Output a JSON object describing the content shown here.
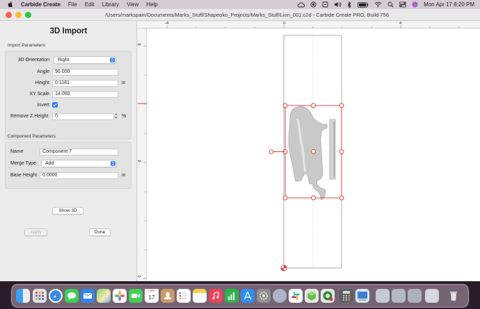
{
  "menubar": {
    "app_name": "Carbide Create",
    "menus": [
      "File",
      "Edit",
      "Library",
      "View",
      "Help"
    ],
    "clock": "Mon Apr 17  8:20 PM",
    "icons": [
      "apple-icon",
      "cloud-icon",
      "record-icon",
      "vpn-icon",
      "volume-icon",
      "bluetooth-icon",
      "battery-icon",
      "wifi-icon",
      "spotlight-icon",
      "control-center-icon",
      "siri-icon"
    ]
  },
  "window": {
    "title": "/Users/markspain/Documents/Marks_Stuff/Shapeoko_Projects/Marks_Stuff/Lion_001.c2d - Carbide Create PRO, Build 756"
  },
  "panel": {
    "title": "3D Import",
    "import_group": {
      "label": "Import Parameters",
      "orientation_label": "3D Orientation",
      "orientation_value": "Right",
      "angle_label": "Angle",
      "angle_value": "90.000",
      "height_label": "Height",
      "height_value": "0.1181",
      "height_unit": "in",
      "xyscale_label": "XY Scale",
      "xyscale_value": "14.000",
      "invert_label": "Invert",
      "invert_checked": true,
      "removez_label": "Remove Z Height",
      "removez_value": "0",
      "removez_unit": "%"
    },
    "component_group": {
      "label": "Component Parameters",
      "name_label": "Name",
      "name_value": "Component 7",
      "merge_label": "Merge Type",
      "merge_value": "Add",
      "base_label": "Base Height",
      "base_value": "0.0000",
      "base_unit": "in"
    },
    "show3d_label": "Show 3D",
    "apply_label": "Apply",
    "done_label": "Done"
  },
  "canvas": {
    "ruler_h": [
      "-4",
      "0",
      "4"
    ],
    "ruler_v": [
      "8",
      "4",
      "0"
    ],
    "accent": "#d9393b"
  },
  "dock": {
    "apps": [
      "finder-icon",
      "launchpad-icon",
      "safari-icon",
      "messages-icon",
      "mail-icon",
      "maps-icon",
      "photos-icon",
      "facetime-icon",
      "calendar-icon",
      "contacts-icon",
      "reminders-icon",
      "notes-icon",
      "music-icon",
      "numbers-icon",
      "appstore-icon",
      "settings-icon",
      "system-icon",
      "slack-icon",
      "carbide-copy-icon",
      "carbide-create-icon",
      "calculator-icon",
      "preview-icon",
      "trash-folder-icon",
      "downloads-icon",
      "stack-icon",
      "trash-icon"
    ]
  }
}
